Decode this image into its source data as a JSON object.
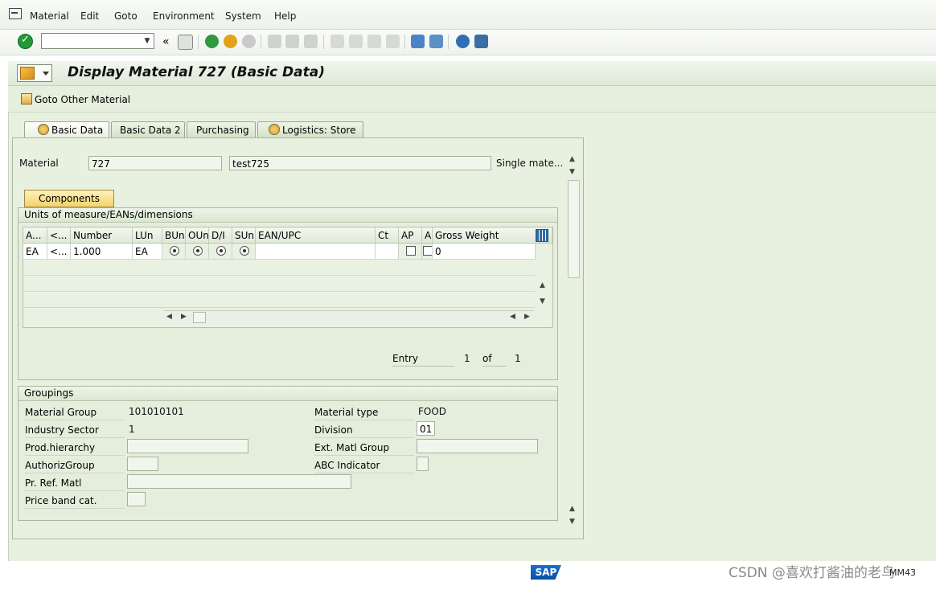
{
  "menu": {
    "items": [
      "Material",
      "Edit",
      "Goto",
      "Environment",
      "System",
      "Help"
    ]
  },
  "toolbar": {
    "command_value": "",
    "back_glyph": "«"
  },
  "title": "Display Material 727 (Basic Data)",
  "appbar": {
    "goto_other": "Goto Other Material"
  },
  "tabs": [
    {
      "label": "Basic Data",
      "active": true
    },
    {
      "label": "Basic Data 2",
      "active": false
    },
    {
      "label": "Purchasing",
      "active": false
    },
    {
      "label": "Logistics: Store",
      "active": false
    }
  ],
  "material": {
    "label": "Material",
    "number": "727",
    "description": "test725",
    "category": "Single mate..."
  },
  "components_button": "Components",
  "uom": {
    "group_title": "Units of measure/EANs/dimensions",
    "columns": [
      "A...",
      "<...",
      "Number",
      "LUn",
      "BUn",
      "OUn",
      "D/I",
      "SUn",
      "EAN/UPC",
      "Ct",
      "AP",
      "A",
      "Gross Weight"
    ],
    "row": {
      "a": "EA",
      "lt": "<...",
      "number": "1.000",
      "lun": "EA",
      "gross_weight": "0"
    },
    "entry_label": "Entry",
    "entry_current": "1",
    "of_label": "of",
    "entry_total": "1"
  },
  "groupings": {
    "title": "Groupings",
    "material_group_label": "Material Group",
    "material_group": "101010101",
    "industry_sector_label": "Industry Sector",
    "industry_sector": "1",
    "prod_hierarchy_label": "Prod.hierarchy",
    "prod_hierarchy": "",
    "authoriz_group_label": "AuthorizGroup",
    "authoriz_group": "",
    "pr_ref_matl_label": "Pr. Ref. Matl",
    "pr_ref_matl": "",
    "price_band_label": "Price band cat.",
    "price_band": "",
    "material_type_label": "Material type",
    "material_type": "FOOD",
    "division_label": "Division",
    "division": "01",
    "ext_matl_group_label": "Ext. Matl Group",
    "ext_matl_group": "",
    "abc_indicator_label": "ABC Indicator",
    "abc_indicator": ""
  },
  "status": {
    "sap_logo": "SAP",
    "transaction": "MM43",
    "watermark": "CSDN @喜欢打酱油的老鸟"
  },
  "colors": {
    "accent_green": "#1f9a36",
    "panel_bg": "#e8f0e0",
    "button_yellow": "#f2d36c",
    "sap_blue": "#0b4fa8"
  }
}
